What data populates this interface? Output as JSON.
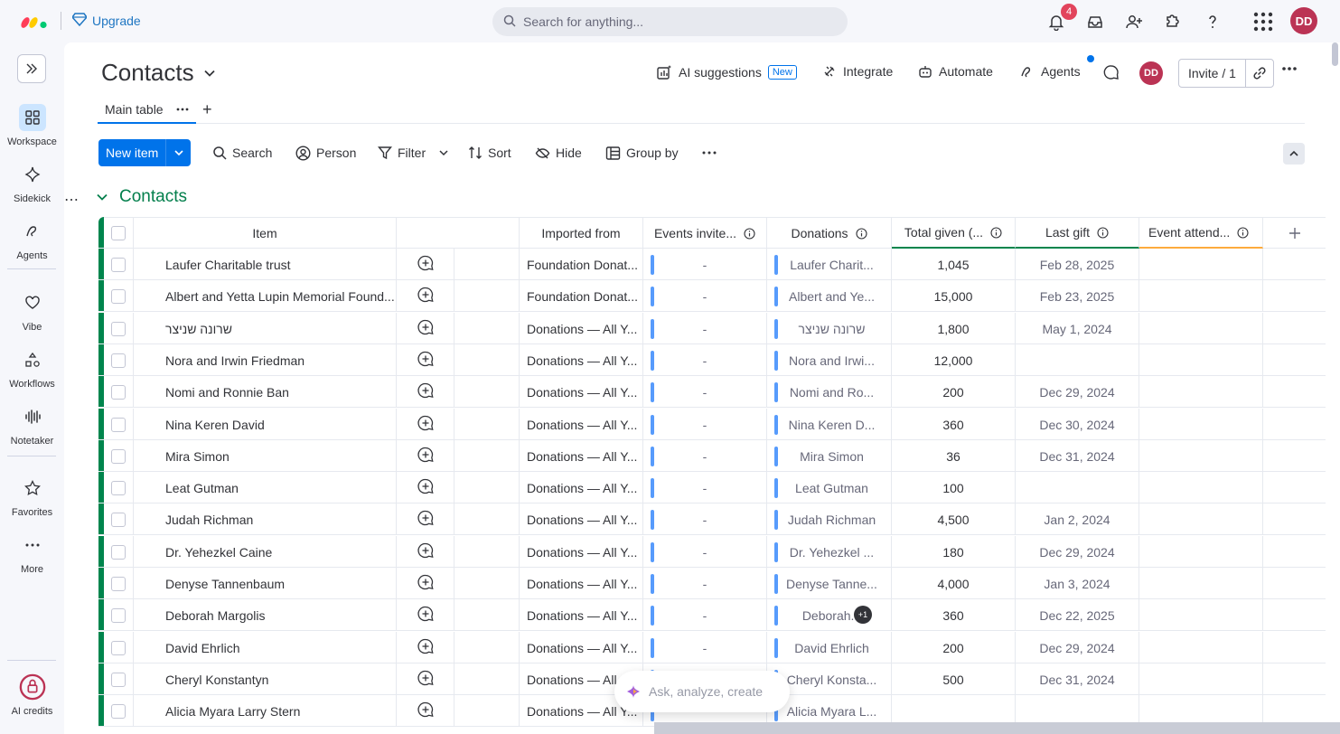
{
  "topbar": {
    "upgrade_label": "Upgrade",
    "search_placeholder": "Search for anything...",
    "notification_count": "4",
    "avatar_initials": "DD"
  },
  "sidebar": {
    "items": [
      {
        "label": "Workspace",
        "icon": "grid-icon",
        "active": true
      },
      {
        "label": "Sidekick",
        "icon": "sparkle-icon"
      },
      {
        "label": "Agents",
        "icon": "agents-icon"
      },
      {
        "label": "Vibe",
        "icon": "heart-icon"
      },
      {
        "label": "Workflows",
        "icon": "workflows-icon"
      },
      {
        "label": "Notetaker",
        "icon": "waveform-icon"
      },
      {
        "label": "Favorites",
        "icon": "star-icon"
      },
      {
        "label": "More",
        "icon": "more-icon"
      }
    ],
    "credits_label": "AI credits"
  },
  "board": {
    "title": "Contacts",
    "actions": {
      "ai_suggestions": "AI suggestions",
      "new_tag": "New",
      "integrate": "Integrate",
      "automate": "Automate",
      "agents": "Agents"
    },
    "avatar_initials": "DD",
    "invite_label": "Invite / 1",
    "tabs": [
      {
        "label": "Main table"
      }
    ]
  },
  "toolbar": {
    "new_item": "New item",
    "search": "Search",
    "person": "Person",
    "filter": "Filter",
    "sort": "Sort",
    "hide": "Hide",
    "group_by": "Group by"
  },
  "group": {
    "title": "Contacts",
    "color": "#037f4c"
  },
  "table": {
    "columns": {
      "item": "Item",
      "imported_from": "Imported from",
      "events_invited": "Events invite...",
      "donations": "Donations",
      "total_given": "Total given (...",
      "last_gift": "Last gift",
      "event_attended": "Event attend..."
    },
    "rows": [
      {
        "name": "Laufer Charitable trust",
        "imported": "Foundation Donat...",
        "events": "-",
        "donation": "Laufer Charit...",
        "total": "1,045",
        "last": "Feb 28, 2025"
      },
      {
        "name": "Albert and Yetta Lupin Memorial Found...",
        "imported": "Foundation Donat...",
        "events": "-",
        "donation": "Albert and Ye...",
        "total": "15,000",
        "last": "Feb 23, 2025"
      },
      {
        "name": "שרונה שניצר",
        "imported": "Donations — All Y...",
        "events": "-",
        "donation": "שרונה שניצר",
        "total": "1,800",
        "last": "May 1, 2024"
      },
      {
        "name": "Nora and Irwin Friedman",
        "imported": "Donations — All Y...",
        "events": "-",
        "donation": "Nora and Irwi...",
        "total": "12,000",
        "last": ""
      },
      {
        "name": "Nomi and Ronnie Ban",
        "imported": "Donations — All Y...",
        "events": "-",
        "donation": "Nomi and Ro...",
        "total": "200",
        "last": "Dec 29, 2024"
      },
      {
        "name": "Nina Keren David",
        "imported": "Donations — All Y...",
        "events": "-",
        "donation": "Nina Keren D...",
        "total": "360",
        "last": "Dec 30, 2024"
      },
      {
        "name": "Mira Simon",
        "imported": "Donations — All Y...",
        "events": "-",
        "donation": "Mira Simon",
        "total": "36",
        "last": "Dec 31, 2024"
      },
      {
        "name": "Leat Gutman",
        "imported": "Donations — All Y...",
        "events": "-",
        "donation": "Leat Gutman",
        "total": "100",
        "last": ""
      },
      {
        "name": "Judah Richman",
        "imported": "Donations — All Y...",
        "events": "-",
        "donation": "Judah Richman",
        "total": "4,500",
        "last": "Jan 2, 2024"
      },
      {
        "name": "Dr. Yehezkel Caine",
        "imported": "Donations — All Y...",
        "events": "-",
        "donation": "Dr. Yehezkel ...",
        "total": "180",
        "last": "Dec 29, 2024"
      },
      {
        "name": "Denyse Tannenbaum",
        "imported": "Donations — All Y...",
        "events": "-",
        "donation": "Denyse Tanne...",
        "total": "4,000",
        "last": "Jan 3, 2024"
      },
      {
        "name": "Deborah Margolis",
        "imported": "Donations — All Y...",
        "events": "-",
        "donation": "Deborah...",
        "extra": "+1",
        "total": "360",
        "last": "Dec 22, 2025"
      },
      {
        "name": "David Ehrlich",
        "imported": "Donations — All Y...",
        "events": "-",
        "donation": "David Ehrlich",
        "total": "200",
        "last": "Dec 29, 2024"
      },
      {
        "name": "Cheryl Konstantyn",
        "imported": "Donations — All",
        "events": "",
        "donation": "Cheryl Konsta...",
        "total": "500",
        "last": "Dec 31, 2024"
      },
      {
        "name": "Alicia Myara Larry Stern",
        "imported": "Donations — All Y...",
        "events": "",
        "donation": "Alicia Myara L...",
        "total": "",
        "last": ""
      }
    ]
  },
  "ask": {
    "placeholder": "Ask, analyze, create"
  }
}
